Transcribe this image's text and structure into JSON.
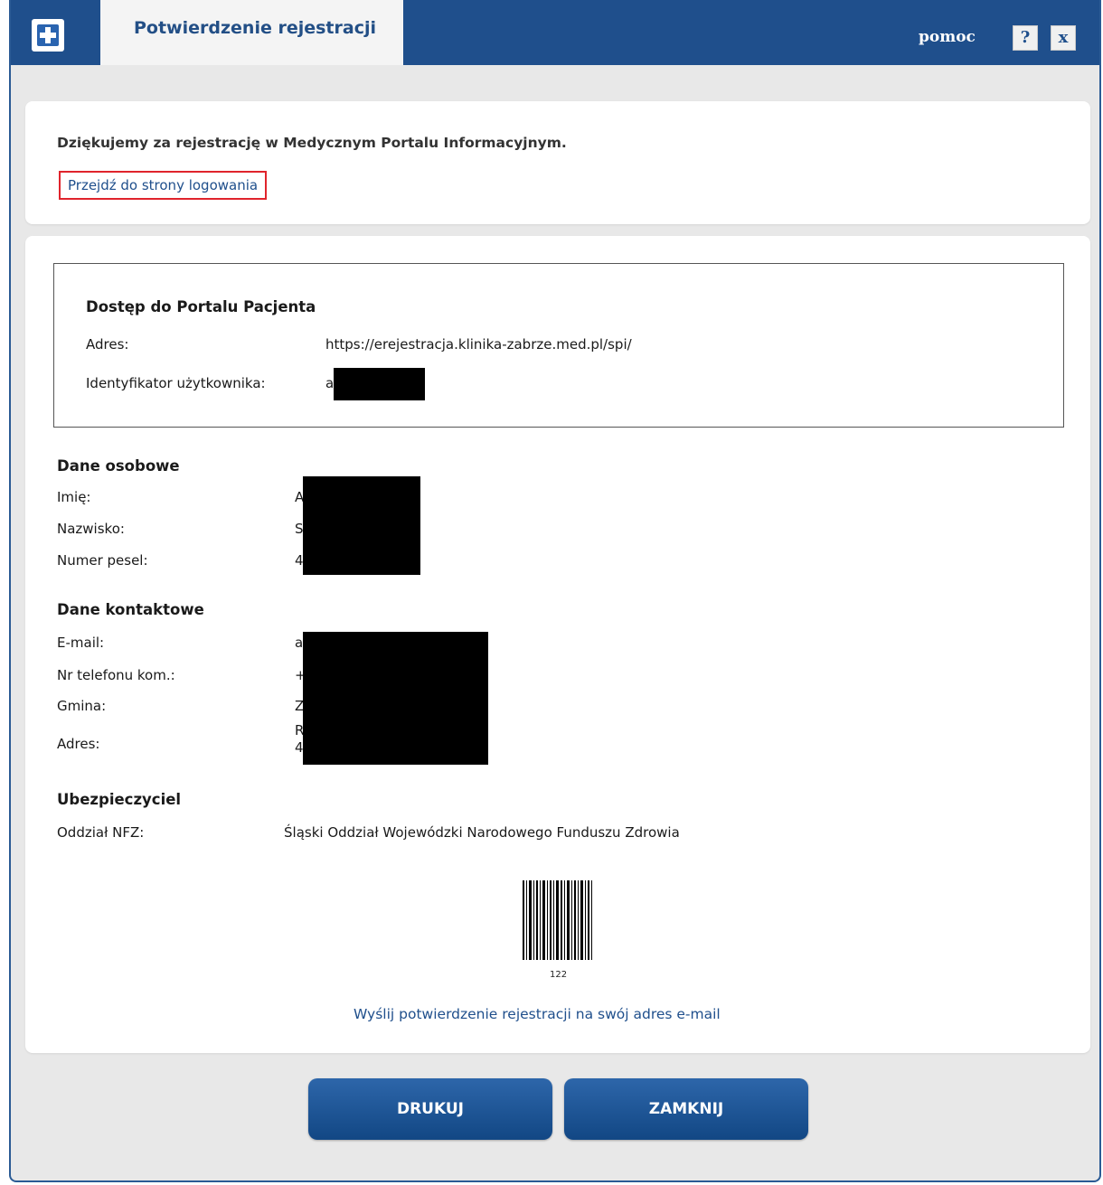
{
  "window": {
    "title": "Potwierdzenie rejestracji",
    "help_label": "pomoc",
    "help_button": "?",
    "close_button": "x"
  },
  "confirmation": {
    "thanks": "Dziękujemy za rejestrację w Medycznym Portalu Informacyjnym.",
    "login_link": "Przejdź do strony logowania"
  },
  "access": {
    "heading": "Dostęp do Portalu Pacjenta",
    "address_label": "Adres:",
    "address_value": "https://erejestracja.klinika-zabrze.med.pl/spi/",
    "user_id_label": "Identyfikator użytkownika:",
    "user_id_value": "a"
  },
  "personal": {
    "heading": "Dane osobowe",
    "first_name_label": "Imię:",
    "first_name_value": "A",
    "last_name_label": "Nazwisko:",
    "last_name_value": "S",
    "pesel_label": "Numer pesel:",
    "pesel_value": "4"
  },
  "contact": {
    "heading": "Dane kontaktowe",
    "email_label": "E-mail:",
    "email_value": "a",
    "phone_label": "Nr telefonu kom.:",
    "phone_value": "+",
    "municipality_label": "Gmina:",
    "municipality_value": "Z",
    "address_label": "Adres:",
    "address_line1": "R",
    "address_line2": "4"
  },
  "insurer": {
    "heading": "Ubezpieczyciel",
    "branch_label": "Oddział NFZ:",
    "branch_value": "Śląski Oddział Wojewódzki Narodowego Funduszu Zdrowia"
  },
  "barcode": {
    "number": "122"
  },
  "send_email_link": "Wyślij potwierdzenie rejestracji na swój adres e-mail",
  "actions": {
    "print": "DRUKUJ",
    "close": "ZAMKNIJ"
  }
}
